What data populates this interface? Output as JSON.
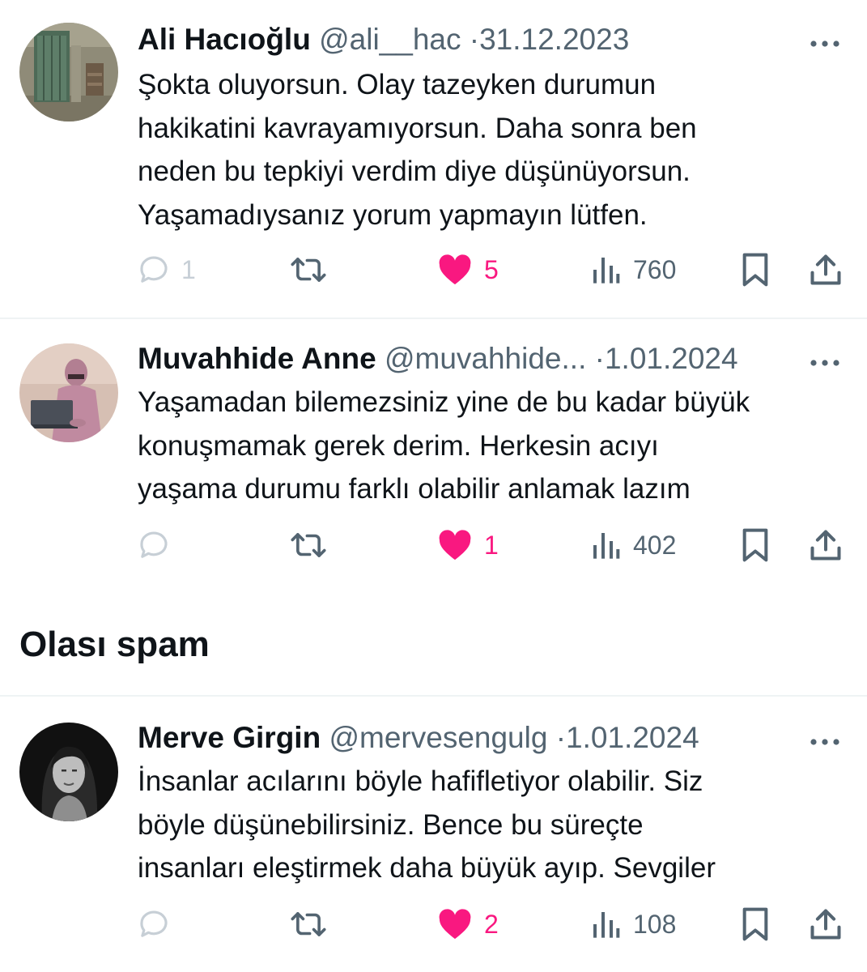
{
  "tweets": [
    {
      "name": "Ali Hacıoğlu",
      "handle": "@ali__hac",
      "separator": "·",
      "date": "31.12.2023",
      "text_lines": [
        "Şokta oluyorsun. Olay tazeyken durumun",
        "hakikatini kavrayamıyorsun. Daha sonra ben",
        "neden bu tepkiyi verdim diye düşünüyorsun.",
        "Yaşamadıysanız yorum yapmayın lütfen."
      ],
      "replies": "1",
      "likes": "5",
      "views": "760",
      "avatar_icon": "door-photo-avatar"
    },
    {
      "name": "Muvahhide Anne",
      "handle": "@muvahhide...",
      "separator": "·",
      "date": "1.01.2024",
      "text_lines": [
        "Yaşamadan bilemezsiniz yine de bu kadar büyük",
        "konuşmamak gerek derim. Herkesin acıyı",
        "yaşama durumu farklı olabilir anlamak lazım"
      ],
      "replies": "",
      "likes": "1",
      "views": "402",
      "avatar_icon": "laptop-woman-avatar"
    },
    {
      "name": "Merve Girgin",
      "handle": "@mervesengulg",
      "separator": "·",
      "date": "1.01.2024",
      "text_lines": [
        "İnsanlar acılarını böyle hafifletiyor olabilir. Siz",
        "böyle düşünebilirsiniz. Bence bu süreçte",
        "insanları eleştirmek daha büyük ayıp. Sevgiler"
      ],
      "replies": "",
      "likes": "2",
      "views": "108",
      "avatar_icon": "bw-portrait-avatar"
    }
  ],
  "section": {
    "title": "Olası spam"
  },
  "icons": {
    "more": "more-dots-icon",
    "reply": "reply-bubble-icon",
    "retweet": "retweet-icon",
    "like": "heart-icon",
    "views": "views-bar-icon",
    "bookmark": "bookmark-icon",
    "share": "share-icon"
  },
  "colors": {
    "like": "#f91880",
    "secondary_text": "#536471",
    "divider": "#eff3f4",
    "reply_inactive": "#c7cfd6"
  }
}
